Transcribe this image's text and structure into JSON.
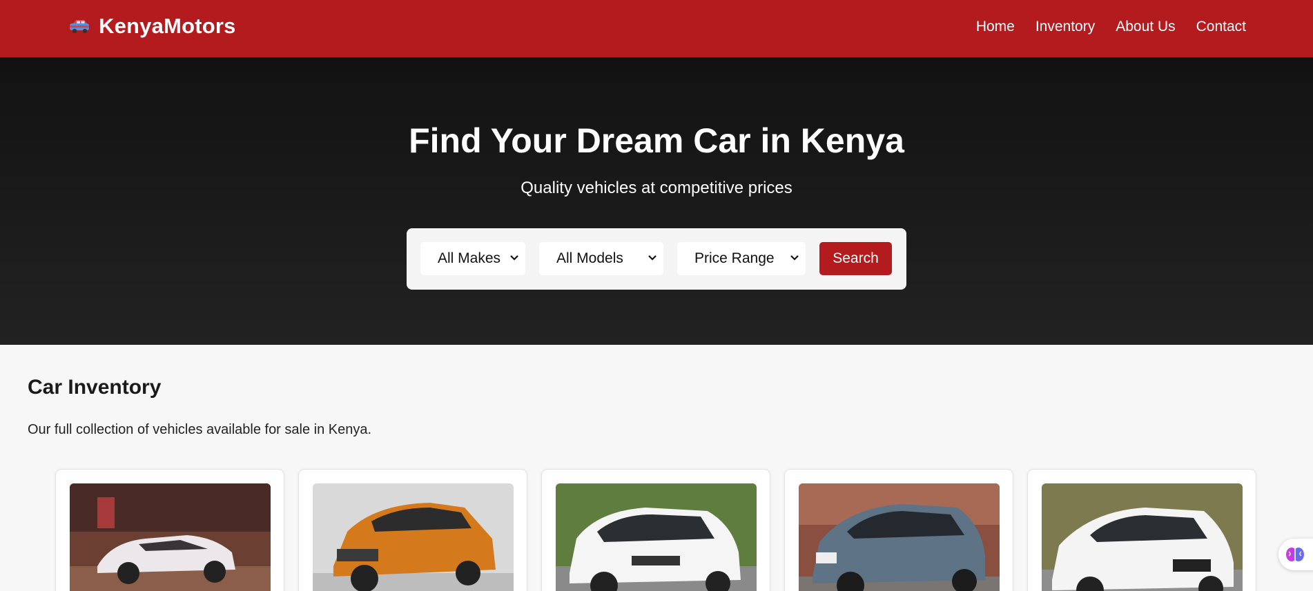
{
  "header": {
    "brand_icon": "car-icon",
    "brand_name": "KenyaMotors",
    "nav": [
      {
        "label": "Home"
      },
      {
        "label": "Inventory"
      },
      {
        "label": "About Us"
      },
      {
        "label": "Contact"
      }
    ],
    "color": "#b41b1f"
  },
  "hero": {
    "title": "Find Your Dream Car in Kenya",
    "subtitle": "Quality vehicles at competitive prices",
    "filters": {
      "make": "All Makes",
      "model": "All Models",
      "price": "Price Range"
    },
    "search_label": "Search"
  },
  "inventory": {
    "title": "Car Inventory",
    "description": "Our full collection of vehicles available for sale in Kenya.",
    "cars": [
      {
        "color": "#e9e4e6",
        "scene": "#7a4b3c"
      },
      {
        "color": "#d57a1c",
        "scene": "#cfcfcf"
      },
      {
        "color": "#f3f3f3",
        "scene": "#6f8a4a"
      },
      {
        "color": "#5e7385",
        "scene": "#9a5a4a"
      },
      {
        "color": "#f1f1f1",
        "scene": "#7c7a4e"
      }
    ]
  },
  "helper_icon": "brain-icon"
}
